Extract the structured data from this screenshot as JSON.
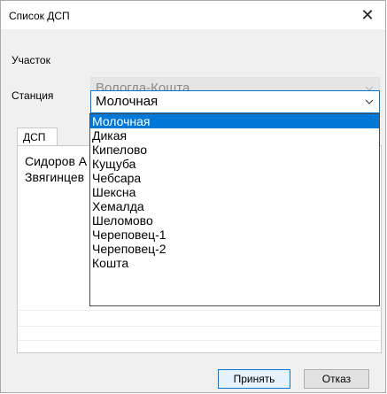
{
  "window": {
    "title": "Список ДСП"
  },
  "fields": {
    "section_label": "Участок",
    "section_value": "Вологда-Кошта",
    "station_label": "Станция",
    "station_value": "Молочная"
  },
  "tab": {
    "label": "ДСП"
  },
  "panel": {
    "rows": [
      "Сидоров А",
      "Звягинцев"
    ]
  },
  "dropdown": {
    "selected_index": 0,
    "options": [
      "Молочная",
      "Дикая",
      "Кипелово",
      "Кущуба",
      "Чебсара",
      "Шексна",
      "Хемалда",
      "Шеломово",
      "Череповец-1",
      "Череповец-2",
      "Кошта"
    ]
  },
  "buttons": {
    "ok": "Принять",
    "cancel": "Отказ"
  },
  "icons": {
    "close": "close-icon",
    "chevron": "chevron-down-icon"
  },
  "colors": {
    "accent": "#0078d7",
    "disabled_text": "#8a8a8a"
  }
}
